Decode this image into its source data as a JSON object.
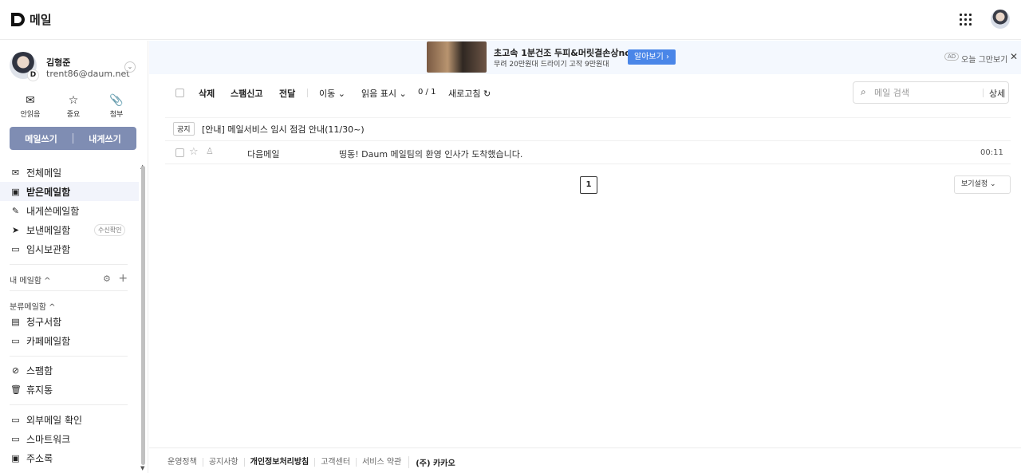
{
  "header": {
    "logo_letter": "D",
    "title": "메일",
    "apps_icon": "grid-icon",
    "avatar": "user-avatar"
  },
  "profile": {
    "name": "김형준",
    "email": "trent86@daum.net",
    "badge": "D"
  },
  "quick_actions": [
    {
      "label": "안읽음",
      "icon": "✉"
    },
    {
      "label": "중요",
      "icon": "☆"
    },
    {
      "label": "첨부",
      "icon": "📎"
    }
  ],
  "write": {
    "compose": "메일쓰기",
    "to_me": "내게쓰기"
  },
  "mailboxes": [
    {
      "label": "전체메일",
      "icon": "✉"
    },
    {
      "label": "받은메일함",
      "icon": "▣",
      "active": true
    },
    {
      "label": "내게쓴메일함",
      "icon": "✎"
    },
    {
      "label": "보낸메일함",
      "icon": "➤",
      "badge": "수신확인"
    },
    {
      "label": "임시보관함",
      "icon": "▭"
    }
  ],
  "my_mailbox": {
    "title": "내 메일함 ^",
    "settings_icon": "⚙",
    "add_icon": "+"
  },
  "categories": {
    "title": "분류메일함 ^",
    "items": [
      {
        "label": "청구서함",
        "icon": "▤"
      },
      {
        "label": "카페메일함",
        "icon": "▭"
      }
    ]
  },
  "junk": [
    {
      "label": "스팸함",
      "icon": "⊘"
    },
    {
      "label": "휴지통",
      "icon": "🗑"
    }
  ],
  "extras": [
    {
      "label": "외부메일 확인",
      "icon": "▭"
    },
    {
      "label": "스마트워크",
      "icon": "▭"
    },
    {
      "label": "주소록",
      "icon": "▣"
    }
  ],
  "ad": {
    "title": "초고속 1분건조 두피&머릿결손상no",
    "subtitle": "무려 20만원대 드라이기 고작 9만원대",
    "button": "알아보기 ›",
    "tag": "AD",
    "hide": "오늘 그만보기",
    "close": "✕"
  },
  "toolbar": {
    "delete": "삭제",
    "spam": "스팸신고",
    "forward": "전달",
    "move": "이동 ⌄",
    "read_mark": "읽음 표시 ⌄",
    "count": "0 / 1",
    "refresh": "새로고침 ↻",
    "search_placeholder": "메일 검색",
    "search_detail": "상세"
  },
  "notice": {
    "tag": "공지",
    "text": "[안내] 메일서비스 임시 점검 안내(11/30~)"
  },
  "messages": [
    {
      "from": "다음메일",
      "subject": "띵동! Daum 메일팀의 환영 인사가 도착했습니다.",
      "time": "00:11"
    }
  ],
  "pagination": {
    "current": "1"
  },
  "view_settings": "보기설정 ⌄",
  "footer": {
    "links": [
      "운영정책",
      "공지사항",
      "개인정보처리방침",
      "고객센터",
      "서비스 약관"
    ],
    "copyright": "(주) 카카오"
  }
}
